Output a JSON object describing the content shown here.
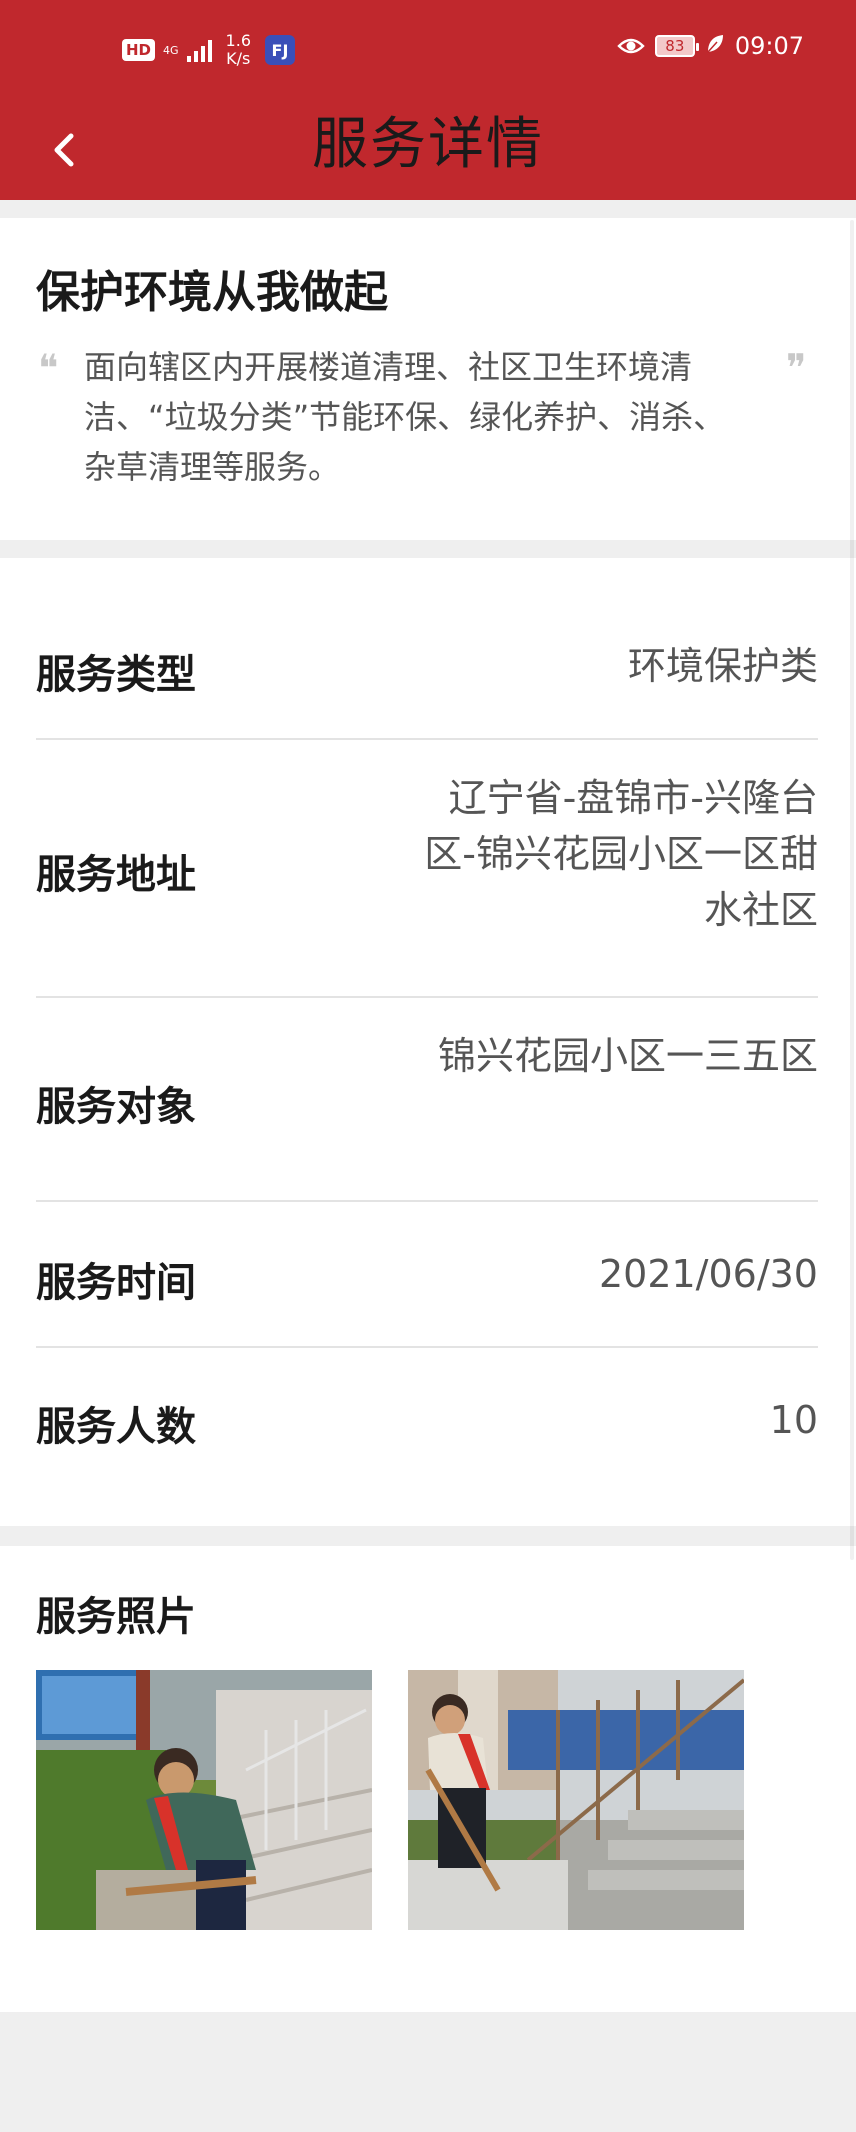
{
  "status_bar": {
    "hd": "HD",
    "network": "4G",
    "speed_value": "1.6",
    "speed_unit": "K/s",
    "app_icon": "FJ",
    "battery": "83",
    "time": "09:07"
  },
  "header": {
    "title": "服务详情",
    "back_icon": "chevron-left-icon"
  },
  "intro": {
    "title": "保护环境从我做起",
    "quote_open": "❝",
    "quote_close": "❞",
    "description": "面向辖区内开展楼道清理、社区卫生环境清洁、“垃圾分类”节能环保、绿化养护、消杀、杂草清理等服务。"
  },
  "details": {
    "type_label": "服务类型",
    "type_value": "环境保护类",
    "address_label": "服务地址",
    "address_value": "辽宁省-盘锦市-兴隆台区-锦兴花园小区一区甜水社区",
    "target_label": "服务对象",
    "target_value": "锦兴花园小区一三五区",
    "time_label": "服务时间",
    "time_value": "2021/06/30",
    "people_label": "服务人数",
    "people_value": "10"
  },
  "photos": {
    "title": "服务照片"
  },
  "colors": {
    "brand_red": "#c0282d",
    "background": "#efefef"
  }
}
